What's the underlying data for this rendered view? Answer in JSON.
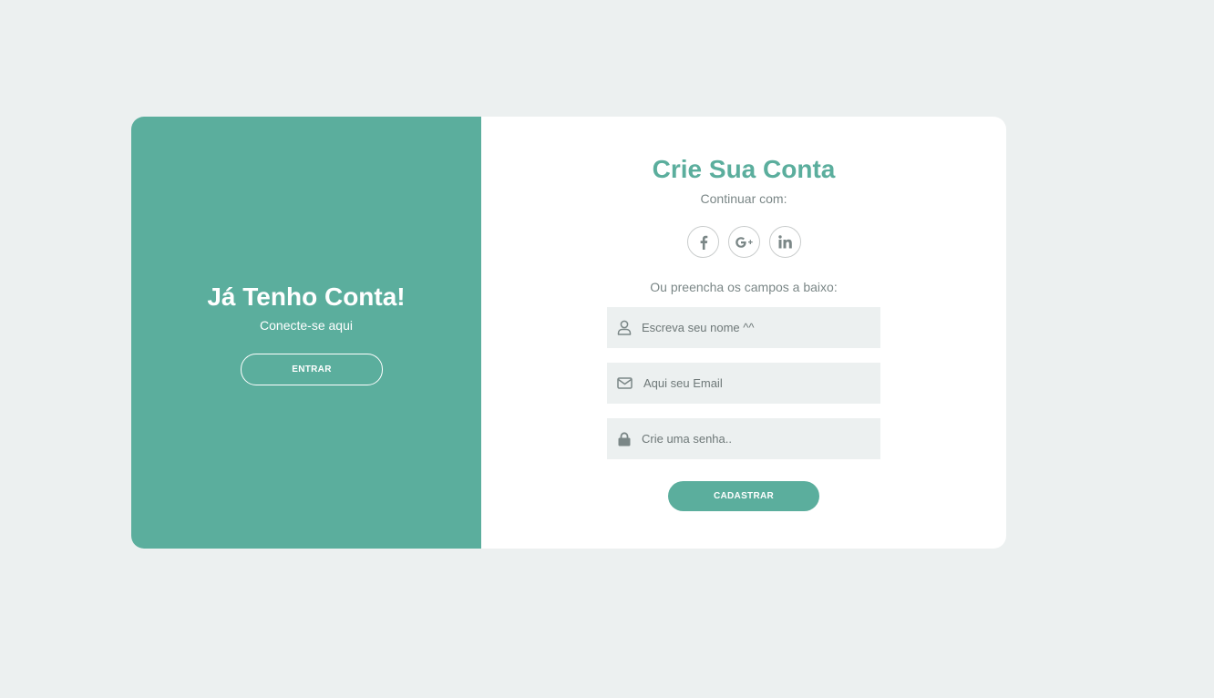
{
  "login_panel": {
    "title": "Já Tenho Conta!",
    "subtitle": "Conecte-se aqui",
    "button_label": "ENTRAR"
  },
  "signup_panel": {
    "title": "Crie Sua Conta",
    "subtitle": "Continuar com:",
    "social_buttons": [
      {
        "icon": "facebook-icon"
      },
      {
        "icon": "google-plus-icon"
      },
      {
        "icon": "linkedin-icon"
      }
    ],
    "alternative_text": "Ou preencha os campos a baixo:",
    "fields": {
      "name": {
        "icon": "user-icon",
        "placeholder": "Escreva seu nome ^^",
        "value": ""
      },
      "email": {
        "icon": "envelope-icon",
        "placeholder": "Aqui seu Email",
        "value": ""
      },
      "password": {
        "icon": "lock-icon",
        "placeholder": "Crie uma senha..",
        "value": ""
      }
    },
    "submit_label": "CADASTRAR"
  },
  "colors": {
    "accent": "#5bae9d",
    "background": "#ecf0f0",
    "card": "#ffffff",
    "muted_text": "#7b8787"
  }
}
